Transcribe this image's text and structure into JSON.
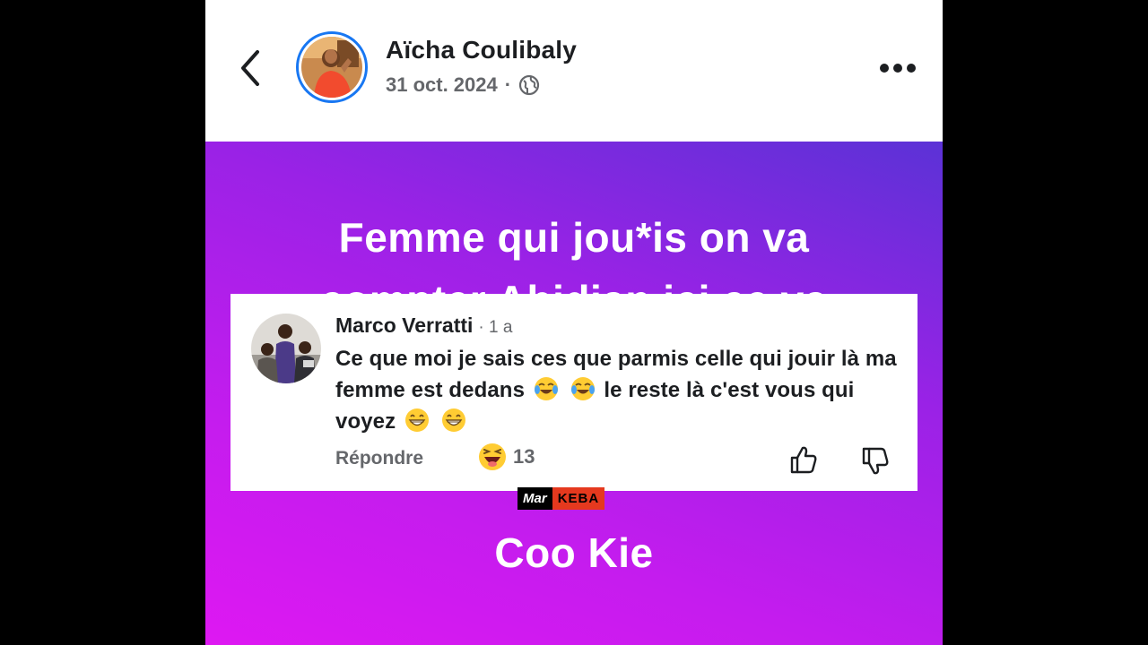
{
  "post": {
    "author": "Aïcha Coulibaly",
    "date": "31 oct. 2024",
    "separator": "·",
    "audience_icon": "globe-icon",
    "more_icon": "more-horizontal-icon",
    "back_icon": "chevron-left-icon",
    "text_line_1": "Femme qui jou*is on va",
    "text_line_2_partial": "compter Abidjan ici ce va",
    "text_line_3": "Coo Kie",
    "background_colors": [
      "#5b32d6",
      "#9a22e6",
      "#c41cee",
      "#de18f2"
    ]
  },
  "comment": {
    "author": "Marco Verratti",
    "time": "· 1 a",
    "text_part_1": "Ce que moi je sais ces que parmis celle qui jouir là ma femme est dedans",
    "text_part_2": "le reste là c'est vous qui voyez",
    "reply_label": "Répondre",
    "reaction_count": "13",
    "reaction_icon": "laughing-emoji-icon",
    "like_icon": "thumbs-up-icon",
    "dislike_icon": "thumbs-down-icon"
  },
  "watermark": {
    "part_1": "Mar",
    "part_2": "KEBA"
  }
}
